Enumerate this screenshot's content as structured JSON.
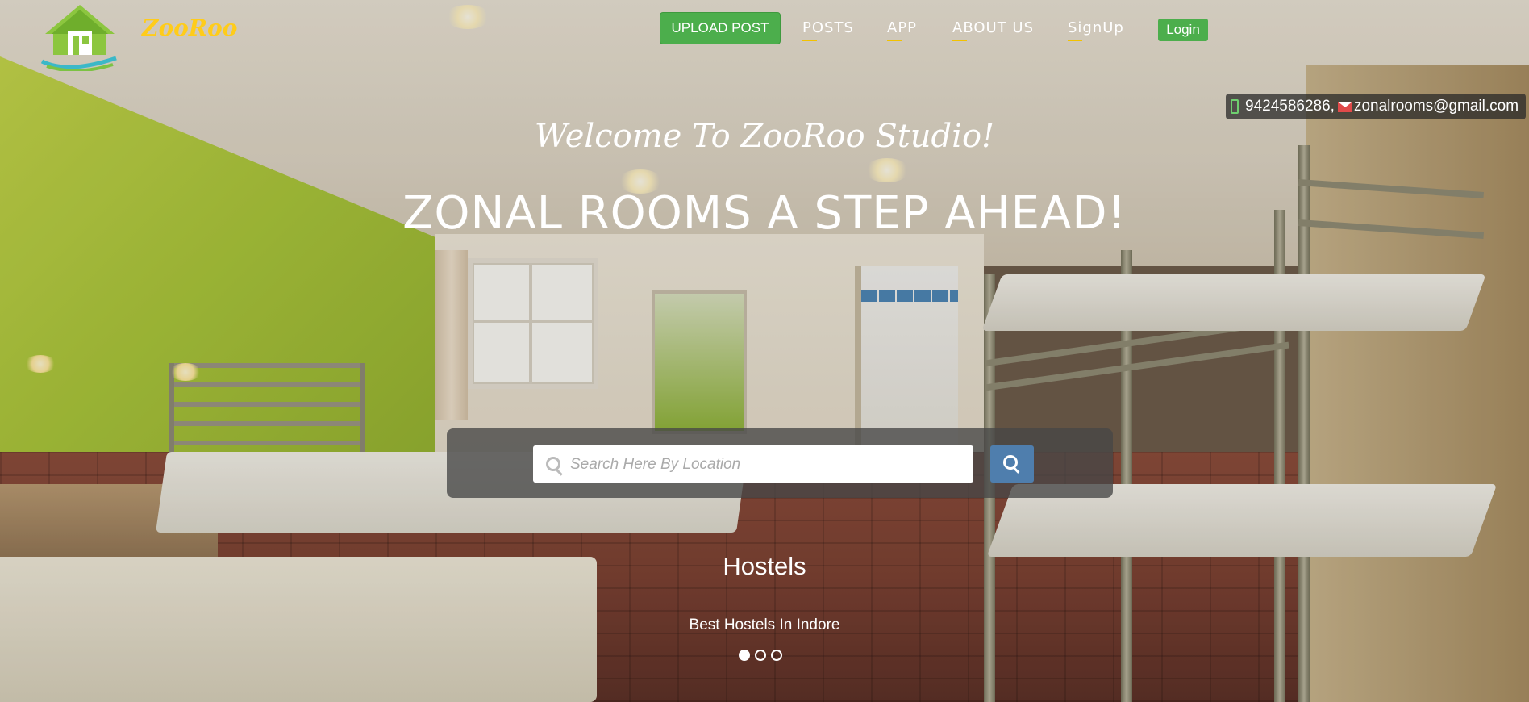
{
  "brand": {
    "name": "ZooRoo",
    "logo_icon": "house-logo-icon"
  },
  "nav": {
    "upload_label": "UPLOAD POST",
    "links": [
      "POSTS",
      "APP",
      "ABOUT US",
      "SignUp"
    ],
    "login_label": "Login"
  },
  "contact": {
    "phone": "9424586286,",
    "email": "zonalrooms@gmail.com"
  },
  "hero": {
    "welcome": "Welcome To ZooRoo Studio!",
    "headline": "ZONAL ROOMS A STEP AHEAD!"
  },
  "search": {
    "placeholder": "Search Here By Location",
    "value": ""
  },
  "carousel": {
    "title": "Hostels",
    "subtitle": "Best Hostels In Indore",
    "slide_count": 3,
    "active_slide": 1
  },
  "colors": {
    "accent_green": "#4cae4c",
    "brand_yellow": "#ffcc1a",
    "search_button_blue": "#4f7ead"
  }
}
